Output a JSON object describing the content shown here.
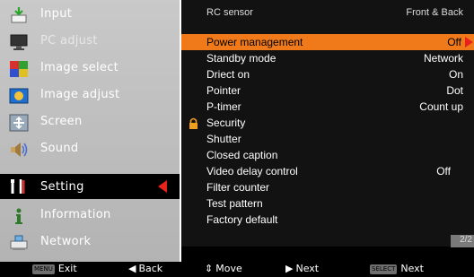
{
  "main_menu": {
    "items": [
      {
        "label": "Input",
        "icon": "input-icon",
        "state": "normal"
      },
      {
        "label": "PC adjust",
        "icon": "monitor-icon",
        "state": "disabled"
      },
      {
        "label": "Image select",
        "icon": "image-select-icon",
        "state": "normal"
      },
      {
        "label": "Image adjust",
        "icon": "image-adjust-icon",
        "state": "normal"
      },
      {
        "label": "Screen",
        "icon": "screen-icon",
        "state": "normal"
      },
      {
        "label": "Sound",
        "icon": "speaker-icon",
        "state": "normal"
      },
      {
        "label": "Setting",
        "icon": "setting-icon",
        "state": "selected"
      },
      {
        "label": "Information",
        "icon": "information-icon",
        "state": "normal"
      },
      {
        "label": "Network",
        "icon": "network-icon",
        "state": "normal"
      }
    ]
  },
  "submenu": {
    "header": {
      "label": "RC sensor",
      "value": "Front & Back"
    },
    "rows": [
      {
        "label": "Power management",
        "value": "Off",
        "active": true
      },
      {
        "label": "Standby mode",
        "value": "Network"
      },
      {
        "label": "Driect on",
        "value": "On"
      },
      {
        "label": "Pointer",
        "value": "Dot"
      },
      {
        "label": "P-timer",
        "value": "Count up"
      },
      {
        "label": "Security",
        "value": "",
        "icon": "lock-icon"
      },
      {
        "label": "Shutter",
        "value": ""
      },
      {
        "label": "Closed caption",
        "value": ""
      },
      {
        "label": "Video delay control",
        "value": "Off"
      },
      {
        "label": "Filter counter",
        "value": ""
      },
      {
        "label": "Test pattern",
        "value": ""
      },
      {
        "label": "Factory default",
        "value": ""
      }
    ],
    "page_indicator": "2/2"
  },
  "guide_bar": {
    "exit": {
      "key": "MENU",
      "label": "Exit"
    },
    "back": {
      "glyph": "◀",
      "label": "Back"
    },
    "move": {
      "glyph": "⇕",
      "label": "Move"
    },
    "next": {
      "glyph": "▶",
      "label": "Next"
    },
    "select": {
      "key": "SELECT",
      "label": "Next"
    }
  },
  "colors": {
    "left_panel": "#bcbcbc",
    "right_panel": "#121212",
    "highlight": "#f07a1a",
    "arrow": "#e8221a"
  }
}
